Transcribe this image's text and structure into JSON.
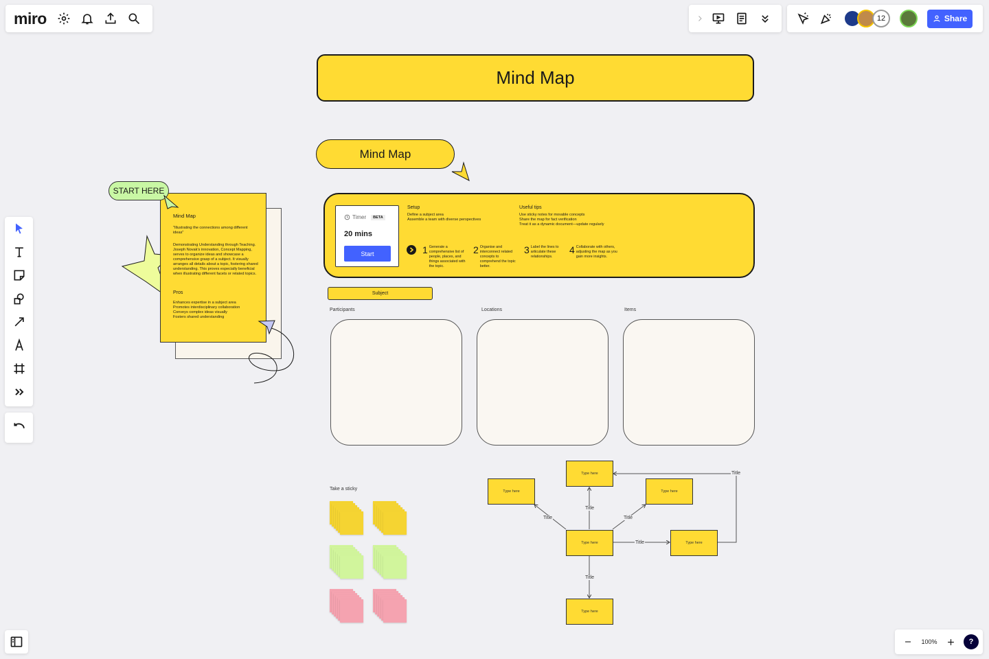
{
  "app": {
    "logo": "miro"
  },
  "topbar": {
    "right_users_count": "12",
    "share_label": "Share"
  },
  "zoom": {
    "level": "100%",
    "help": "?"
  },
  "board": {
    "main_title": "Mind Map",
    "sub_title": "Mind Map",
    "start_here": "START HERE",
    "card": {
      "title": "Mind Map",
      "quote": "\"Illustrating the connections among different ideas\"",
      "body": "Demonstrating Understanding through Teaching. Joseph Novak's innovation, Concept Mapping, serves to organize ideas and showcase a comprehensive grasp of a subject. It visually arranges all details about a topic, fostering shared understanding. This proves especially beneficial when illustrating different facets or related topics.",
      "pros_title": "Pros",
      "pros": [
        "Enhances expertise in a subject area",
        "Promotes interdisciplinary collaboration",
        "Conveys complex ideas visually",
        " Fosters shared understanding"
      ]
    },
    "timer": {
      "label": "Timer",
      "badge": "BETA",
      "duration": "20 mins",
      "start": "Start"
    },
    "setup": {
      "title": "Setup",
      "lines": [
        "Define a subject area",
        "Assemble a team with diverse perspectives"
      ]
    },
    "tips": {
      "title": "Useful tips",
      "lines": [
        "Use sticky notes for movable concepts",
        "Share the map for fact verification",
        "Treat it as a dynamic document—update regularly"
      ]
    },
    "steps": [
      {
        "num": "1",
        "text": "Generate a comprehensive list of people, places, and things associated with the topic."
      },
      {
        "num": "2",
        "text": "Organise and interconnect related concepts to comprehend the topic better."
      },
      {
        "num": "3",
        "text": "Label the lines to articulate these relationships."
      },
      {
        "num": "4",
        "text": "Collaborate with others, adjusting the map as you gain more insights."
      }
    ],
    "subject": "Subject",
    "columns": [
      "Participants",
      "Locations",
      "Items"
    ],
    "take_sticky": "Take a sticky",
    "mindmap": {
      "node_text": "Type here",
      "edge_label": "Title"
    }
  },
  "colors": {
    "yellow": "#ffdb33",
    "green": "#c9f07f",
    "pink": "#f5a3b0",
    "blue": "#4262ff"
  }
}
